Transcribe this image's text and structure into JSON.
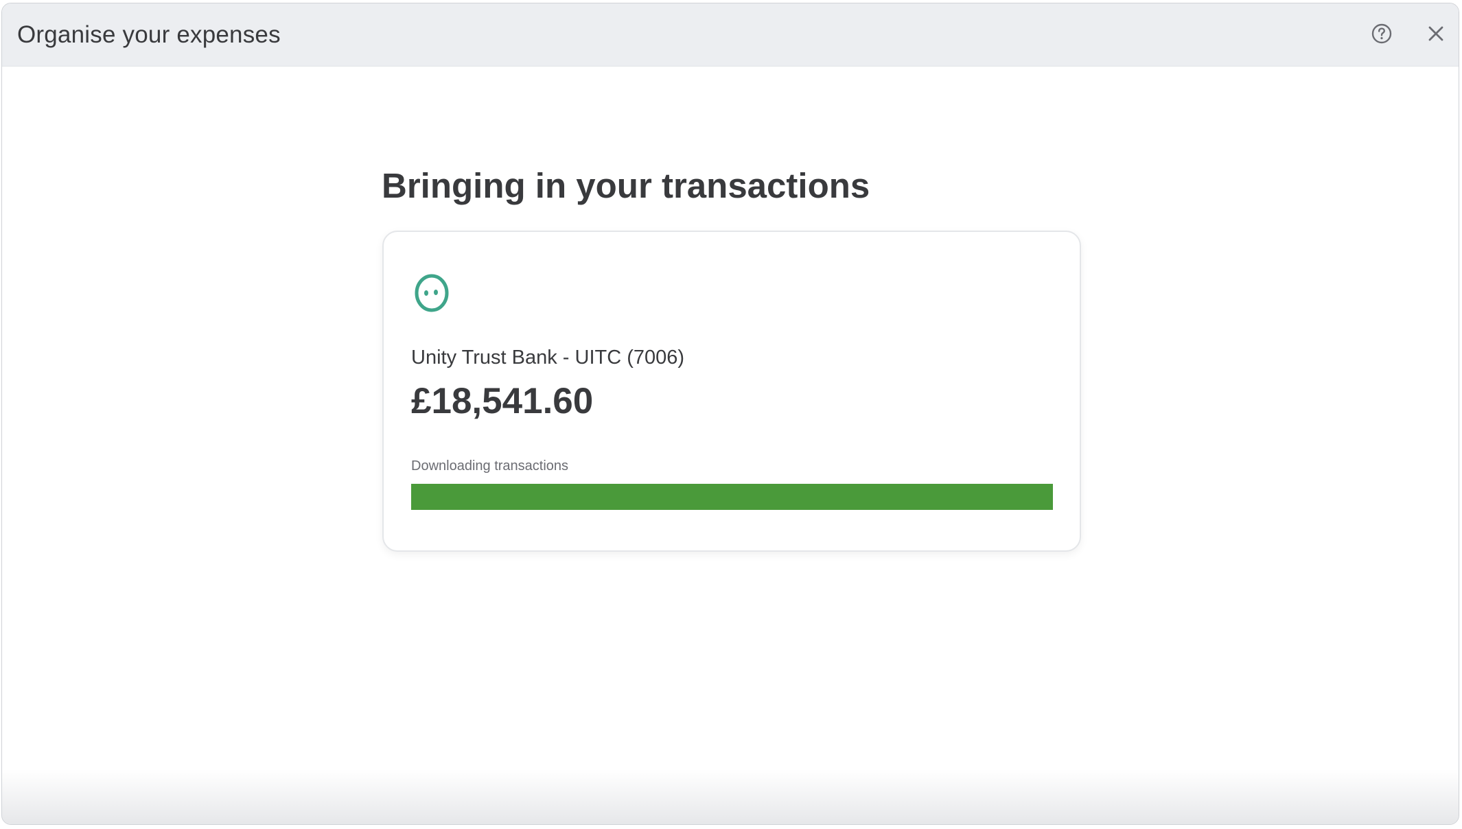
{
  "window": {
    "title": "Organise your expenses",
    "help_icon": "help-circle-icon",
    "close_icon": "close-icon"
  },
  "main": {
    "heading": "Bringing in your transactions"
  },
  "account_card": {
    "logo_icon": "bank-logo-icon",
    "bank_name": "Unity Trust Bank - UITC (7006)",
    "balance": "£18,541.60",
    "status_text": "Downloading transactions",
    "progress_percent": 100
  },
  "colors": {
    "progress": "#4a9a3a",
    "logo_ring": "#3fa58a",
    "text": "#393a3d"
  }
}
